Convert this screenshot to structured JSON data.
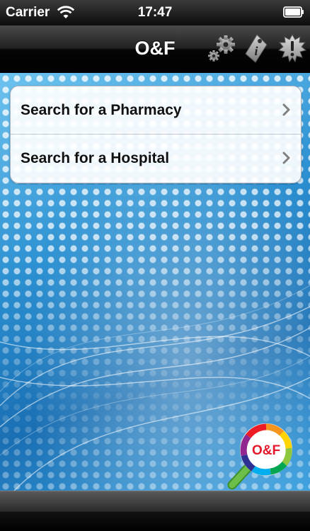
{
  "status_bar": {
    "carrier": "Carrier",
    "time": "17:47"
  },
  "nav_bar": {
    "title": "O&F",
    "buttons": [
      "gear-icon",
      "info-icon",
      "alert-icon"
    ]
  },
  "menu": {
    "items": [
      {
        "label": "Search for a Pharmacy",
        "icon": "chevron-right-icon"
      },
      {
        "label": "Search for a Hospital",
        "icon": "chevron-right-icon"
      }
    ]
  },
  "logo": {
    "text": "O&F",
    "icon": "magnifier-logo-icon"
  },
  "colors": {
    "background_blue": "#2b8fd0",
    "logo_red": "#e4182a",
    "logo_handle_green": "#6cc04a",
    "nav_bar_black": "#0c0c0c"
  }
}
